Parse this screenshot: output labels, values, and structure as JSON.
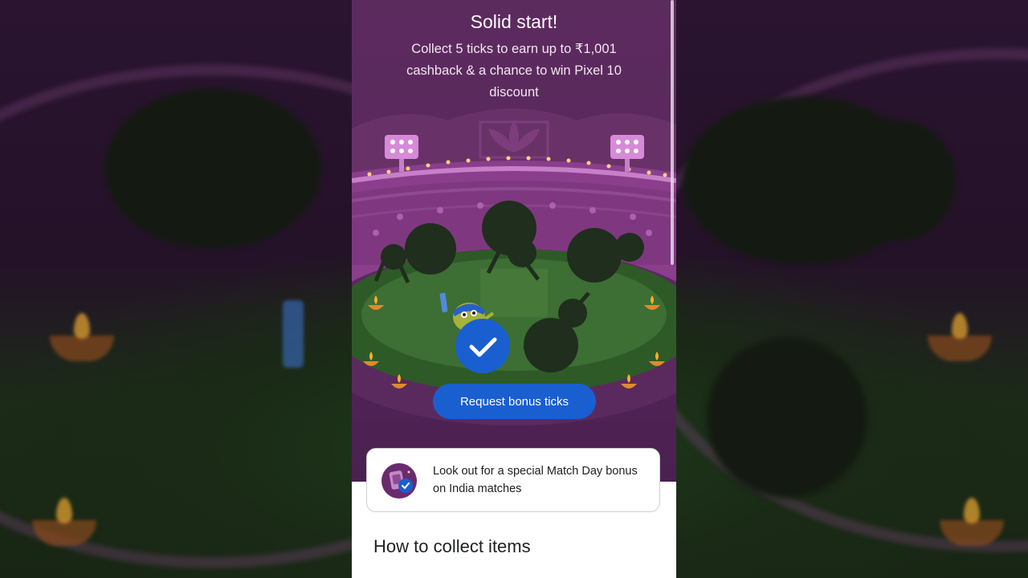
{
  "hero": {
    "title": "Solid start!",
    "subtitle": "Collect 5 ticks to earn up to ₹1,001 cashback & a chance to win Pixel 10 discount"
  },
  "scene": {
    "collected_ticks": 1,
    "icons": [
      "stadium-lights-icon",
      "diya-icon",
      "cricket-bat-icon",
      "checkmark-icon",
      "lotus-icon"
    ]
  },
  "actions": {
    "request_bonus_label": "Request bonus ticks"
  },
  "match_day": {
    "text": "Look out for a special Match Day bonus on India matches",
    "icon": "phone-tick-icon"
  },
  "section": {
    "how_to_title": "How to collect items"
  },
  "colors": {
    "accent_blue": "#1a5fd0",
    "hero_purple": "#5a285c",
    "field_green": "#2e5a28"
  }
}
